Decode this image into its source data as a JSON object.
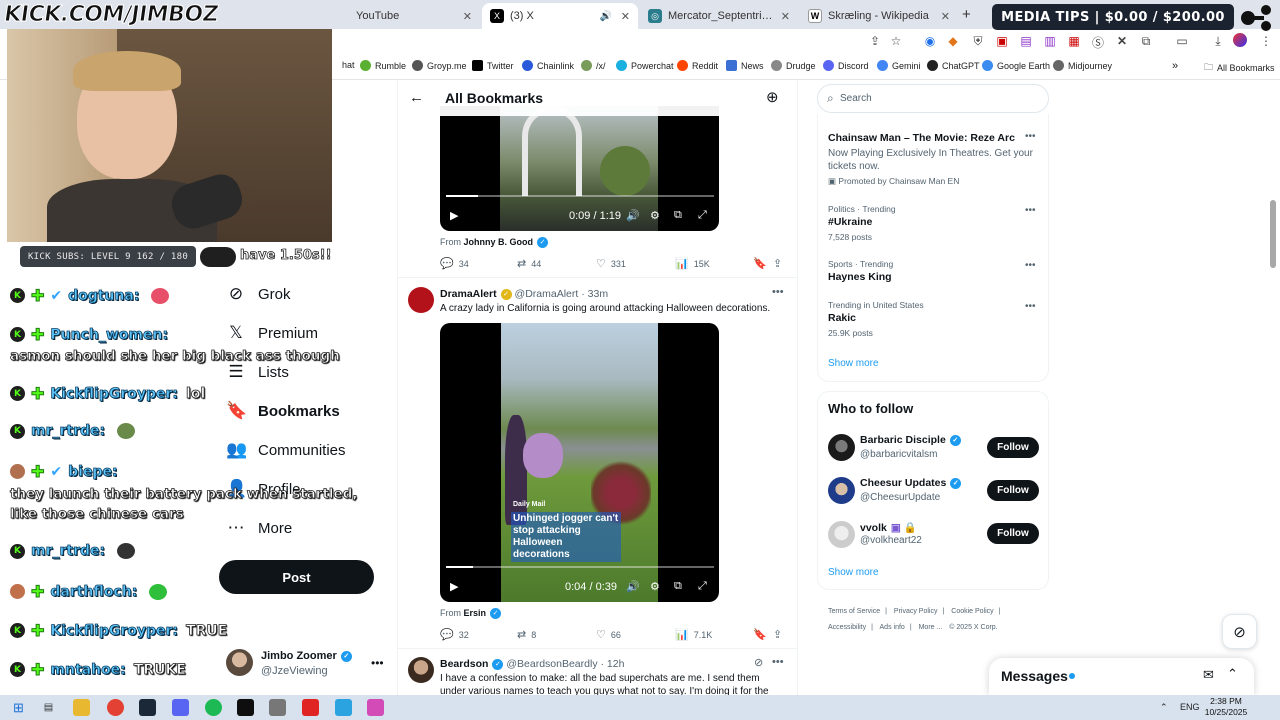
{
  "overlay": {
    "url_text": "KICK.COM/JIMBOZ",
    "kick_subs": "KICK SUBS: LEVEL 9 162 / 180",
    "media_tips": "MEDIA TIPS | $0.00 / $200.00",
    "partial_text": "have 1.50s!!"
  },
  "browser": {
    "tabs": [
      {
        "label": "YouTube",
        "icon": "youtube-icon"
      },
      {
        "label": "(3) X",
        "icon": "x-icon"
      },
      {
        "label": "Mercator_Septentrionalium_Te",
        "icon": "globe-icon"
      },
      {
        "label": "Skræling - Wikipedia",
        "icon": "wikipedia-icon"
      }
    ],
    "bookmarks": [
      "hat",
      "Rumble",
      "Groyp.me",
      "Twitter",
      "Chainlink",
      "/x/",
      "Powerchat",
      "Reddit",
      "News",
      "Drudge",
      "Discord",
      "Gemini",
      "ChatGPT",
      "Google Earth",
      "Midjourney"
    ],
    "all_bookmarks": "All Bookmarks"
  },
  "nav": {
    "items": [
      {
        "label": "Grok",
        "icon": "grok-icon"
      },
      {
        "label": "Premium",
        "icon": "x-logo-icon"
      },
      {
        "label": "Lists",
        "icon": "lists-icon"
      },
      {
        "label": "Bookmarks",
        "icon": "bookmark-icon"
      },
      {
        "label": "Communities",
        "icon": "communities-icon"
      },
      {
        "label": "Profile",
        "icon": "profile-icon"
      },
      {
        "label": "More",
        "icon": "more-icon"
      }
    ],
    "post_label": "Post",
    "account": {
      "name": "Jimbo Zoomer",
      "handle": "@JzeViewing"
    }
  },
  "timeline": {
    "title": "All Bookmarks",
    "tweets": [
      {
        "video_time": "0:09 / 1:19",
        "progress": 0.12,
        "from_label": "From",
        "from_name": "Johnny B. Good",
        "replies": "34",
        "reposts": "44",
        "likes": "331",
        "views": "15K"
      },
      {
        "author": "DramaAlert",
        "handle": "@DramaAlert",
        "time": "33m",
        "text": "A crazy lady in California is going around attacking Halloween decorations.",
        "video_brand": "Daily Mail",
        "video_caption": "Unhinged jogger can't stop attacking Halloween decorations",
        "video_time": "0:04 / 0:39",
        "progress": 0.1,
        "from_label": "From",
        "from_name": "Ersin",
        "replies": "32",
        "reposts": "8",
        "likes": "66",
        "views": "7.1K"
      },
      {
        "author": "Beardson",
        "handle": "@BeardsonBeardly",
        "time": "12h",
        "text": "I have a confession to make: all the bad superchats are me. I send them under various names to teach you guys what not to say. I'm doing it for the"
      }
    ]
  },
  "sidebar": {
    "search_placeholder": "Search",
    "promo": {
      "title": "Chainsaw Man – The Movie: Reze Arc",
      "body": "Now Playing Exclusively In Theatres. Get your tickets now.",
      "promoted": "Promoted by Chainsaw Man EN"
    },
    "trends": [
      {
        "meta": "Politics · Trending",
        "title": "#Ukraine",
        "count": "7,528 posts"
      },
      {
        "meta": "Sports · Trending",
        "title": "Haynes King",
        "count": ""
      },
      {
        "meta": "Trending in United States",
        "title": "Rakic",
        "count": "25.9K posts"
      }
    ],
    "show_more": "Show more",
    "who_to_follow": "Who to follow",
    "follow_label": "Follow",
    "suggestions": [
      {
        "name": "Barbaric Disciple",
        "handle": "@barbaricvitalsm"
      },
      {
        "name": "Cheesur Updates",
        "handle": "@CheesurUpdate"
      },
      {
        "name": "vvolk",
        "handle": "@volkheart22"
      }
    ],
    "footer": [
      "Terms of Service",
      "Privacy Policy",
      "Cookie Policy",
      "Accessibility",
      "Ads info",
      "More ...",
      "© 2025 X Corp."
    ],
    "messages": "Messages"
  },
  "chat": [
    {
      "user": "dogtuna:",
      "msg": "",
      "badges": [
        "kick",
        "sub",
        "verified"
      ]
    },
    {
      "user": "Punch_women:",
      "msg": "",
      "badges": [
        "kick",
        "sub"
      ]
    },
    {
      "line": "asmon should she her big black ass though"
    },
    {
      "user": "KickflipGroyper:",
      "msg": "lol",
      "badges": [
        "kick",
        "sub"
      ]
    },
    {
      "user": "mr_rtrde:",
      "msg": "",
      "badges": [
        "kick"
      ]
    },
    {
      "user": "biepe:",
      "msg": "",
      "badges": [
        "avatar",
        "sub",
        "verified"
      ]
    },
    {
      "line": "they launch their battery pack when startled,"
    },
    {
      "line": "like those chinese cars"
    },
    {
      "user": "mr_rtrde:",
      "msg": "",
      "badges": [
        "kick"
      ]
    },
    {
      "user": "darthfloch:",
      "msg": "",
      "badges": [
        "avatar",
        "sub"
      ]
    },
    {
      "user": "KickflipGroyper:",
      "msg": "TRUE",
      "badges": [
        "kick",
        "sub"
      ]
    },
    {
      "user": "mntahoe:",
      "msg": "TRUKE",
      "badges": [
        "kick",
        "sub"
      ]
    }
  ],
  "taskbar": {
    "lang": "ENG",
    "time": "2:38 PM",
    "date": "10/25/2025"
  }
}
